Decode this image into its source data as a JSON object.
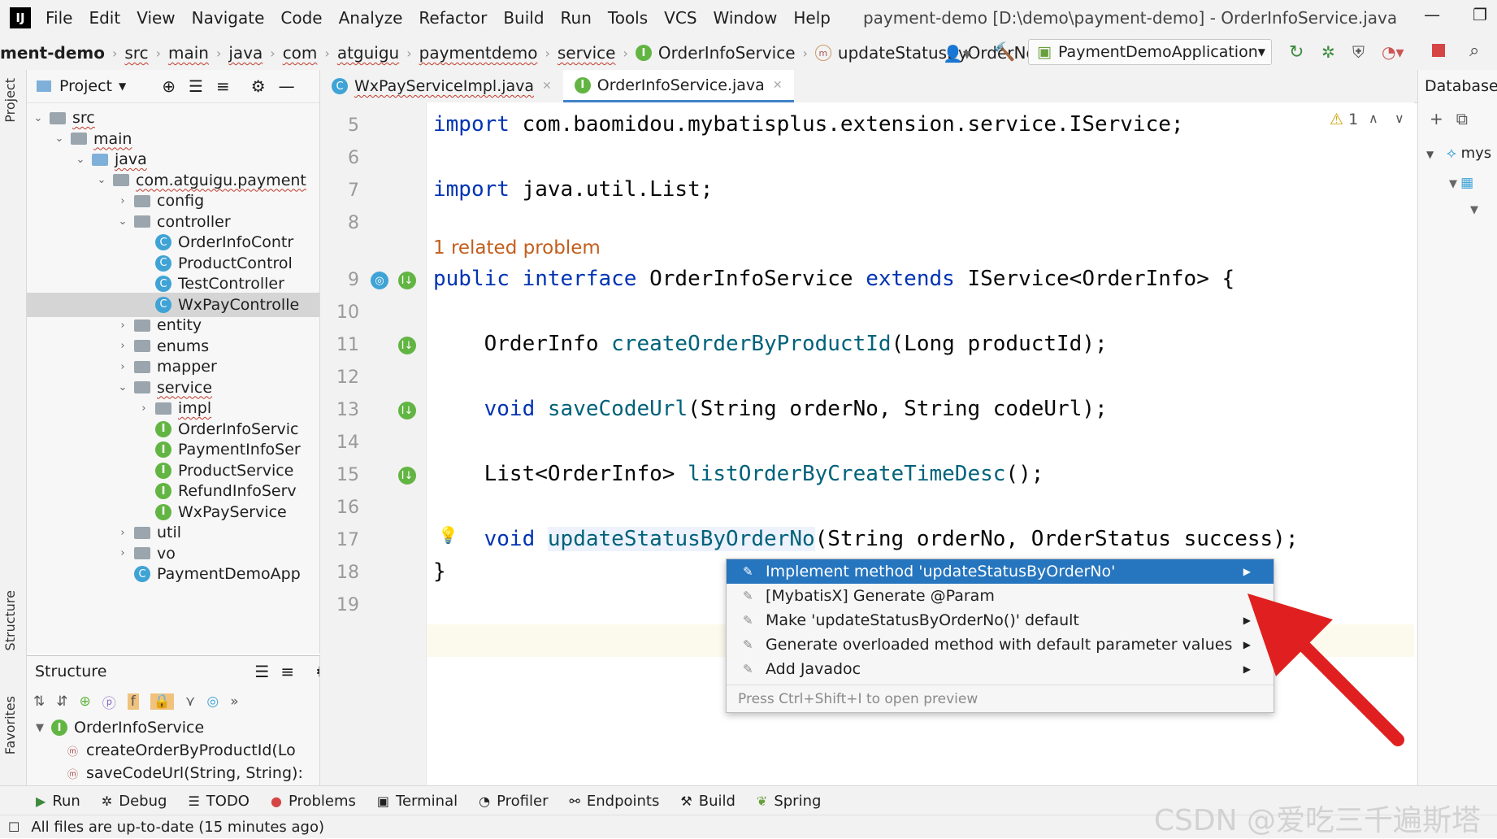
{
  "menubar": {
    "items": [
      "File",
      "Edit",
      "View",
      "Navigate",
      "Code",
      "Analyze",
      "Refactor",
      "Build",
      "Run",
      "Tools",
      "VCS",
      "Window",
      "Help"
    ],
    "title": "payment-demo [D:\\demo\\payment-demo] - OrderInfoService.java"
  },
  "navbar": {
    "crumbs": [
      "ment-demo",
      "src",
      "main",
      "java",
      "com",
      "atguigu",
      "paymentdemo",
      "service",
      "OrderInfoService",
      "updateStatusByOrderNo"
    ],
    "run_config": "PaymentDemoApplication"
  },
  "side_labels": {
    "project": "Project",
    "structure": "Structure",
    "favorites": "Favorites"
  },
  "project_panel": {
    "title": "Project",
    "tree": [
      {
        "label": "src",
        "depth": 1,
        "kind": "folder",
        "open": true
      },
      {
        "label": "main",
        "depth": 2,
        "kind": "folder",
        "open": true
      },
      {
        "label": "java",
        "depth": 3,
        "kind": "folder-blue",
        "open": true
      },
      {
        "label": "com.atguigu.payment",
        "depth": 4,
        "kind": "package",
        "open": true
      },
      {
        "label": "config",
        "depth": 5,
        "kind": "package",
        "open": false
      },
      {
        "label": "controller",
        "depth": 5,
        "kind": "package",
        "open": true
      },
      {
        "label": "OrderInfoContr",
        "depth": 6,
        "kind": "class"
      },
      {
        "label": "ProductControl",
        "depth": 6,
        "kind": "class"
      },
      {
        "label": "TestController",
        "depth": 6,
        "kind": "class"
      },
      {
        "label": "WxPayControlle",
        "depth": 6,
        "kind": "class",
        "selected": true
      },
      {
        "label": "entity",
        "depth": 5,
        "kind": "package",
        "open": false
      },
      {
        "label": "enums",
        "depth": 5,
        "kind": "package",
        "open": false
      },
      {
        "label": "mapper",
        "depth": 5,
        "kind": "package",
        "open": false
      },
      {
        "label": "service",
        "depth": 5,
        "kind": "package",
        "open": true
      },
      {
        "label": "impl",
        "depth": 6,
        "kind": "package",
        "open": false
      },
      {
        "label": "OrderInfoServic",
        "depth": 6,
        "kind": "interface"
      },
      {
        "label": "PaymentInfoSer",
        "depth": 6,
        "kind": "interface"
      },
      {
        "label": "ProductService",
        "depth": 6,
        "kind": "interface"
      },
      {
        "label": "RefundInfoServ",
        "depth": 6,
        "kind": "interface"
      },
      {
        "label": "WxPayService",
        "depth": 6,
        "kind": "interface"
      },
      {
        "label": "util",
        "depth": 5,
        "kind": "package",
        "open": false
      },
      {
        "label": "vo",
        "depth": 5,
        "kind": "package",
        "open": false
      },
      {
        "label": "PaymentDemoApp",
        "depth": 5,
        "kind": "class"
      }
    ]
  },
  "structure_panel": {
    "title": "Structure",
    "root": "OrderInfoService",
    "members": [
      "createOrderByProductId(Lo",
      "saveCodeUrl(String, String):"
    ]
  },
  "tabs": [
    {
      "label": "WxPayServiceImpl.java",
      "active": false
    },
    {
      "label": "OrderInfoService.java",
      "active": true
    }
  ],
  "editor": {
    "warning_count": "1",
    "problem_hint": "1 related problem",
    "line_numbers": [
      "5",
      "6",
      "7",
      "8",
      "9",
      "10",
      "11",
      "12",
      "13",
      "14",
      "15",
      "16",
      "17",
      "18",
      "19"
    ]
  },
  "popup": {
    "items": [
      {
        "label": "Implement method 'updateStatusByOrderNo'",
        "selected": true
      },
      {
        "label": "[MybatisX] Generate @Param",
        "selected": false
      },
      {
        "label": "Make 'updateStatusByOrderNo()' default",
        "selected": false
      },
      {
        "label": "Generate overloaded method with default parameter values",
        "selected": false
      },
      {
        "label": "Add Javadoc",
        "selected": false
      }
    ],
    "hint": "Press Ctrl+Shift+I to open preview"
  },
  "right_panel": {
    "title": "Database",
    "item": "mys"
  },
  "bottom_tools": [
    "Run",
    "Debug",
    "TODO",
    "Problems",
    "Terminal",
    "Profiler",
    "Endpoints",
    "Build",
    "Spring"
  ],
  "status": "All files are up-to-date (15 minutes ago)",
  "watermark": "CSDN @爱吃三千遍斯塔",
  "colors": {
    "accent": "#2675bf",
    "keyword": "#0033b3",
    "method": "#00627a",
    "arrow": "#e02020"
  }
}
